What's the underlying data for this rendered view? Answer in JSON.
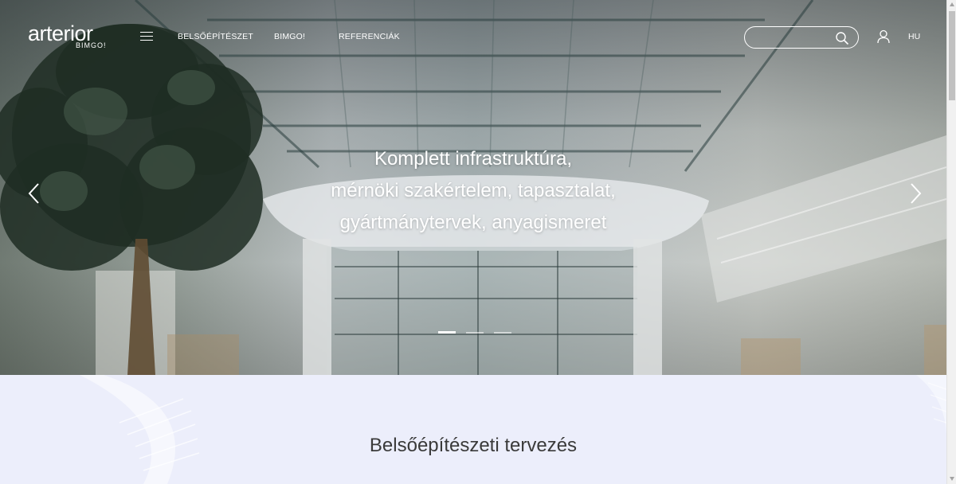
{
  "header": {
    "logo_text": "arterior",
    "logo_subtext": "BIMGO!",
    "nav": [
      {
        "label": "BELSŐÉPÍTÉSZET"
      },
      {
        "label": "BIMGO!"
      },
      {
        "label": "REFERENCIÁK"
      }
    ],
    "search_value": "",
    "search_placeholder": "",
    "language": "HU"
  },
  "hero": {
    "headline_lines": [
      "Komplett infrastruktúra,",
      "mérnöki szakértelem, tapasztalat,",
      "gyártmánytervek, anyagismeret"
    ],
    "slides_total": 3,
    "active_slide": 1
  },
  "section": {
    "title": "Belsőépítészeti tervezés",
    "peek_text": "· · ·"
  },
  "colors": {
    "section_bg": "#eceefb",
    "hero_text": "#ffffff",
    "title_text": "#3a3a3a"
  },
  "icons": [
    "hamburger-menu-icon",
    "search-icon",
    "user-icon",
    "chevron-left-icon",
    "chevron-right-icon"
  ]
}
